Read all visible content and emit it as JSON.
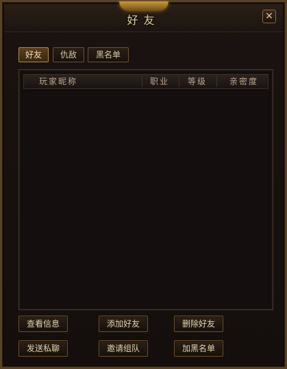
{
  "window": {
    "title": "好友",
    "close_symbol": "✕",
    "close_icon": "close-icon"
  },
  "tabs": [
    {
      "label": "好友",
      "active": true
    },
    {
      "label": "仇敌",
      "active": false
    },
    {
      "label": "黑名单",
      "active": false
    }
  ],
  "list": {
    "columns": [
      "玩家昵称",
      "职业",
      "等级",
      "亲密度"
    ],
    "rows": []
  },
  "actions": {
    "view_info": "查看信息",
    "add_friend": "添加好友",
    "delete_friend": "删除好友",
    "send_private": "发送私聊",
    "invite_team": "邀请组队",
    "add_blacklist": "加黑名单"
  },
  "colors": {
    "accent_gold": "#c89a3a",
    "text": "#e3d3b2",
    "panel_bg": "#140f0d"
  }
}
